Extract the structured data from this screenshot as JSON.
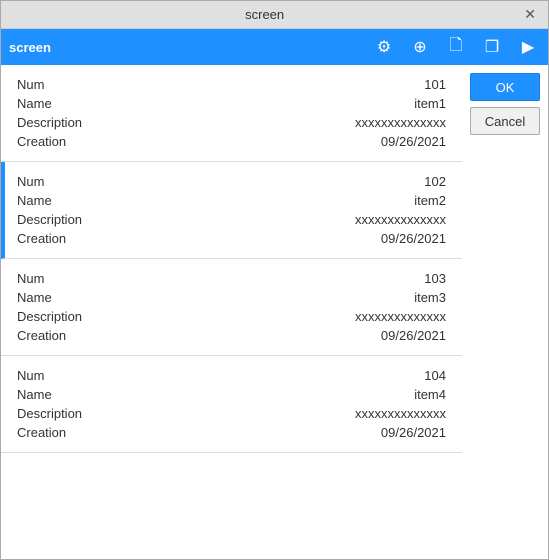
{
  "window": {
    "title": "screen",
    "close_label": "✕"
  },
  "toolbar": {
    "title": "screen",
    "icons": [
      "gear",
      "globe",
      "file",
      "copy",
      "play"
    ]
  },
  "buttons": {
    "ok": "OK",
    "cancel": "Cancel"
  },
  "records": [
    {
      "id": 1,
      "selected": false,
      "fields": {
        "num_label": "Num",
        "num_value": "101",
        "name_label": "Name",
        "name_value": "item1",
        "desc_label": "Description",
        "desc_value": "xxxxxxxxxxxxxx",
        "creation_label": "Creation",
        "creation_value": "09/26/2021"
      }
    },
    {
      "id": 2,
      "selected": true,
      "fields": {
        "num_label": "Num",
        "num_value": "102",
        "name_label": "Name",
        "name_value": "item2",
        "desc_label": "Description",
        "desc_value": "xxxxxxxxxxxxxx",
        "creation_label": "Creation",
        "creation_value": "09/26/2021"
      }
    },
    {
      "id": 3,
      "selected": false,
      "fields": {
        "num_label": "Num",
        "num_value": "103",
        "name_label": "Name",
        "name_value": "item3",
        "desc_label": "Description",
        "desc_value": "xxxxxxxxxxxxxx",
        "creation_label": "Creation",
        "creation_value": "09/26/2021"
      }
    },
    {
      "id": 4,
      "selected": false,
      "fields": {
        "num_label": "Num",
        "num_value": "104",
        "name_label": "Name",
        "name_value": "item4",
        "desc_label": "Description",
        "desc_value": "xxxxxxxxxxxxxx",
        "creation_label": "Creation",
        "creation_value": "09/26/2021"
      }
    }
  ]
}
